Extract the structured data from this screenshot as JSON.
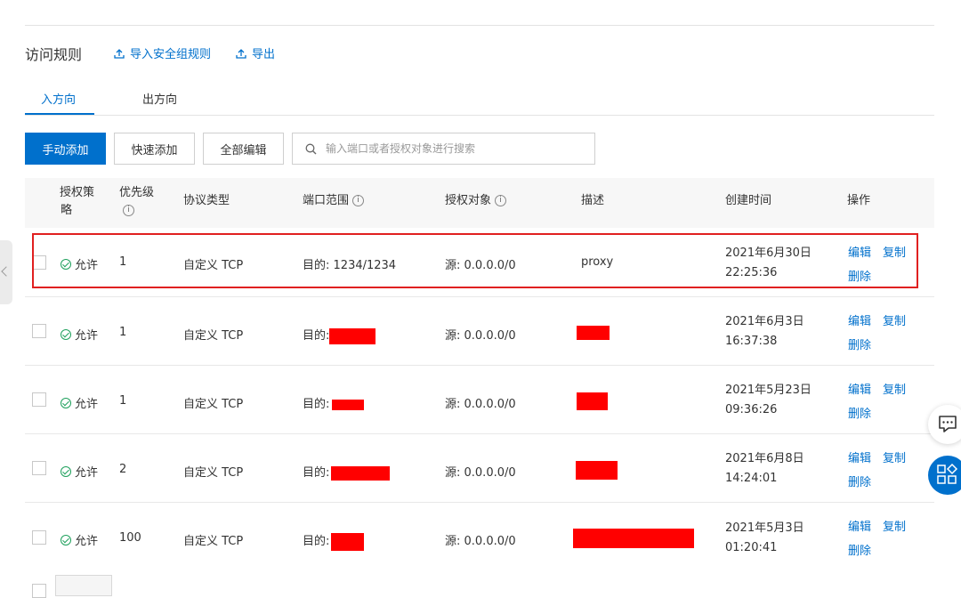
{
  "header": {
    "title": "访问规则",
    "import_label": "导入安全组规则",
    "export_label": "导出"
  },
  "tabs": [
    {
      "label": "入方向",
      "active": true
    },
    {
      "label": "出方向",
      "active": false
    }
  ],
  "toolbar": {
    "manual_add": "手动添加",
    "quick_add": "快速添加",
    "edit_all": "全部编辑",
    "search_placeholder": "输入端口或者授权对象进行搜索"
  },
  "table": {
    "columns": {
      "policy_line1": "授权策",
      "policy_line2": "略",
      "priority": "优先级",
      "protocol": "协议类型",
      "port_range": "端口范围",
      "auth_object": "授权对象",
      "description": "描述",
      "created": "创建时间",
      "actions": "操作"
    },
    "rows": [
      {
        "policy": "允许",
        "priority": "1",
        "protocol": "自定义 TCP",
        "port_prefix": "目的:",
        "port": "1234/1234",
        "source": "源: 0.0.0.0/0",
        "description": "proxy",
        "date": "2021年6月30日",
        "time": "22:25:36",
        "highlighted": true
      },
      {
        "policy": "允许",
        "priority": "1",
        "protocol": "自定义 TCP",
        "port_prefix": "目的:",
        "port": "",
        "source": "源: 0.0.0.0/0",
        "description": "",
        "date": "2021年6月3日",
        "time": "16:37:38"
      },
      {
        "policy": "允许",
        "priority": "1",
        "protocol": "自定义 TCP",
        "port_prefix": "目的:",
        "port": "",
        "source": "源: 0.0.0.0/0",
        "description": "",
        "date": "2021年5月23日",
        "time": "09:36:26"
      },
      {
        "policy": "允许",
        "priority": "2",
        "protocol": "自定义 TCP",
        "port_prefix": "目的:",
        "port": "",
        "source": "源: 0.0.0.0/0",
        "description": "",
        "date": "2021年6月8日",
        "time": "14:24:01"
      },
      {
        "policy": "允许",
        "priority": "100",
        "protocol": "自定义 TCP",
        "port_prefix": "目的:",
        "port": "",
        "source": "源: 0.0.0.0/0",
        "description": "",
        "date": "2021年5月3日",
        "time": "01:20:41"
      }
    ],
    "action_labels": {
      "edit": "编辑",
      "copy": "复制",
      "delete": "删除"
    }
  },
  "colors": {
    "accent": "#0070cc",
    "allow": "#1ea05c",
    "redaction": "#ff0000",
    "highlight": "#e02020"
  },
  "icons": [
    "upload-icon",
    "search-icon",
    "info-icon",
    "check-circle-icon",
    "chat-icon",
    "apps-icon",
    "chevron-left-icon"
  ]
}
